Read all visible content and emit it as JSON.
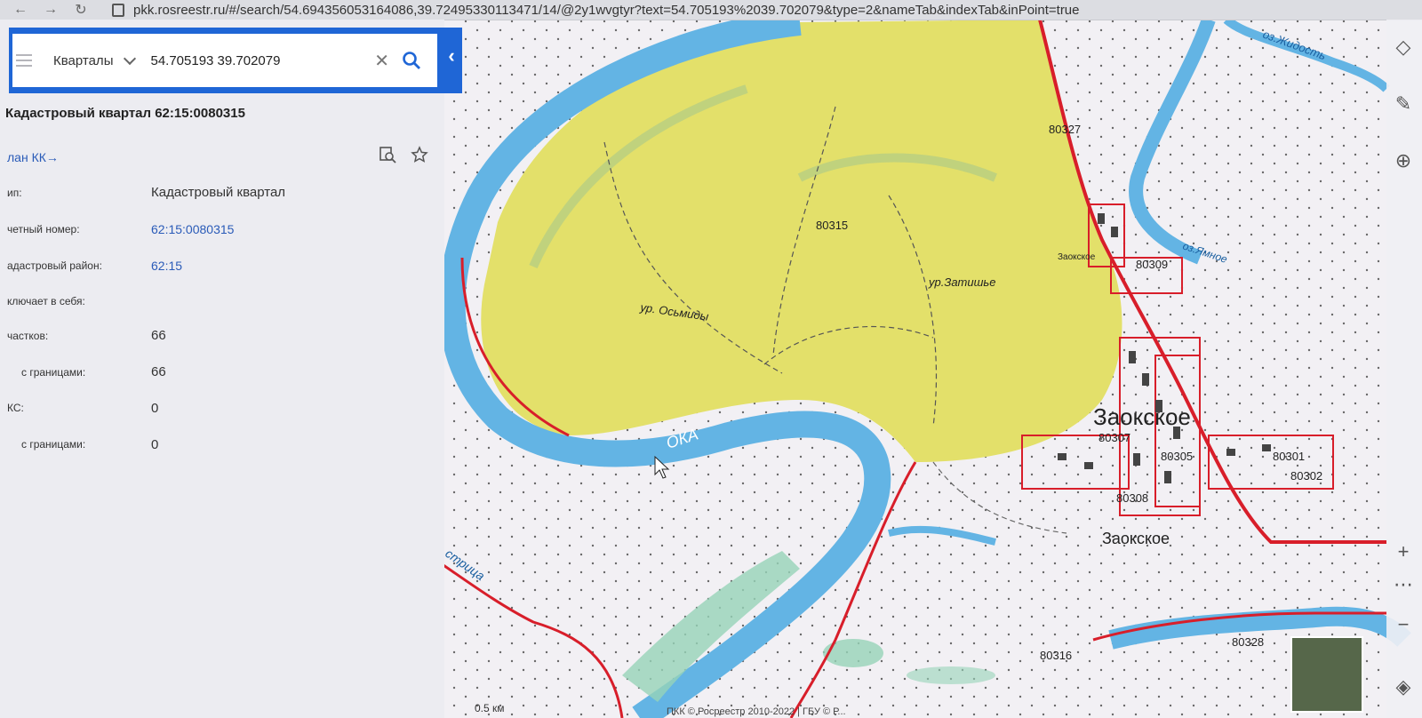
{
  "browser": {
    "url": "pkk.rosreestr.ru/#/search/54.69435605316408​6,39.72495330113471/14/@2y1wvgtyr?text=54.705193%2039.702079&type=2&nameTab&indexTab&inPoint=true"
  },
  "search": {
    "layer_label": "Кварталы",
    "query": "54.705193 39.702079"
  },
  "panel": {
    "title": "Кадастровый квартал 62:15:0080315",
    "plan_link": "лан КК→",
    "rows": [
      {
        "label": "ип:",
        "value": "Кадастровый квартал",
        "link": false
      },
      {
        "label": "четный номер:",
        "value": "62:15:0080315",
        "link": true
      },
      {
        "label": "адастровый район:",
        "value": "62:15",
        "link": true
      },
      {
        "label": "ключает в себя:",
        "value": "",
        "link": false
      },
      {
        "label": "частков:",
        "value": "66",
        "link": false
      },
      {
        "label": "с границами:",
        "value": "66",
        "link": false
      },
      {
        "label": "КС:",
        "value": "0",
        "link": false
      },
      {
        "label": "с границами:",
        "value": "0",
        "link": false
      }
    ]
  },
  "map": {
    "labels": {
      "q80327": "80327",
      "q80315": "80315",
      "q80309": "80309",
      "q80307": "80307",
      "q80305": "80305",
      "q80301": "80301",
      "q80302": "80302",
      "q80308": "80308",
      "q80316": "80316",
      "q80328": "80328",
      "town": "Заокское",
      "town2": "Заокское",
      "zaoksk_small": "Заокское",
      "river": "ОКА",
      "ur_osmidy": "ур. Осьмиды",
      "ur_zatishye": "ур.Затишье",
      "lake": "оз.Ямное",
      "strica": "стрица",
      "zhidost": "оз.Жидость"
    },
    "scale_label": "0.5 км",
    "footer": "ПКК © Росреестр 2010-2022 | ГБУ © Р..."
  },
  "colors": {
    "accent": "#1f66d6",
    "parcel_fill": "#e3e06a",
    "boundary": "#d81e2a",
    "water": "#63b4e4",
    "meadow": "#96d3b8"
  }
}
